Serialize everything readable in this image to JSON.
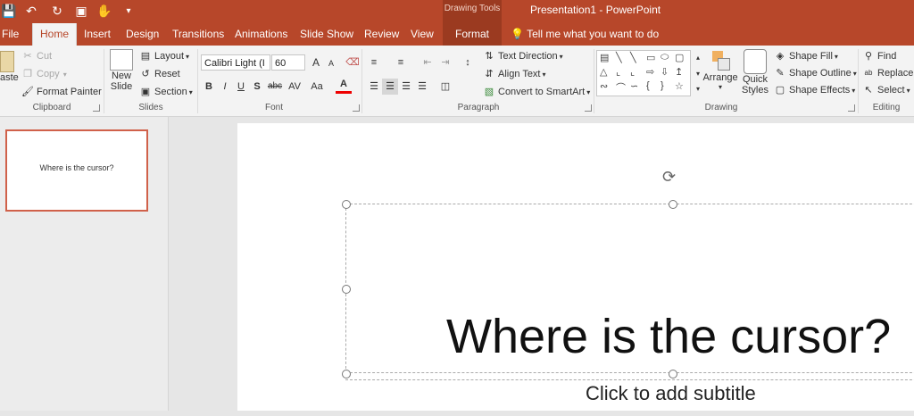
{
  "titlebar": {
    "context_label": "Drawing Tools",
    "doc_title": "Presentation1 - PowerPoint",
    "qat": [
      "save-icon",
      "undo-icon",
      "redo-icon",
      "presenter-icon",
      "touch-icon",
      "customize-icon"
    ]
  },
  "tabs": [
    "File",
    "Home",
    "Insert",
    "Design",
    "Transitions",
    "Animations",
    "Slide Show",
    "Review",
    "View",
    "Format"
  ],
  "tell_me": "Tell me what you want to do",
  "ribbon": {
    "clipboard": {
      "paste": "aste",
      "cut": "Cut",
      "copy": "Copy",
      "format_painter": "Format Painter",
      "label": "Clipboard"
    },
    "slides": {
      "new_slide_1": "New",
      "new_slide_2": "Slide",
      "layout": "Layout",
      "reset": "Reset",
      "section": "Section",
      "label": "Slides"
    },
    "font": {
      "font_name": "Calibri Light (I",
      "font_size": "60",
      "bold": "B",
      "italic": "I",
      "underline": "U",
      "shadow": "S",
      "strike": "abc",
      "spacing": "AV",
      "case": "Aa",
      "color": "A",
      "grow": "A",
      "shrink": "A",
      "label": "Font"
    },
    "paragraph": {
      "text_direction": "Text Direction",
      "align_text": "Align Text",
      "convert_smartart": "Convert to SmartArt",
      "label": "Paragraph"
    },
    "drawing": {
      "arrange": "Arrange",
      "quick_1": "Quick",
      "quick_2": "Styles",
      "shape_fill": "Shape Fill",
      "shape_outline": "Shape Outline",
      "shape_effects": "Shape Effects",
      "label": "Drawing"
    },
    "editing": {
      "find": "Find",
      "replace": "Replace",
      "select": "Select",
      "label": "Editing"
    }
  },
  "thumbnail": {
    "text": "Where is the cursor?"
  },
  "slide": {
    "title": "Where is the cursor?",
    "subtitle": "Click to add subtitle"
  },
  "colors": {
    "accent": "#b7472a",
    "context_band": "#9b3a20"
  }
}
